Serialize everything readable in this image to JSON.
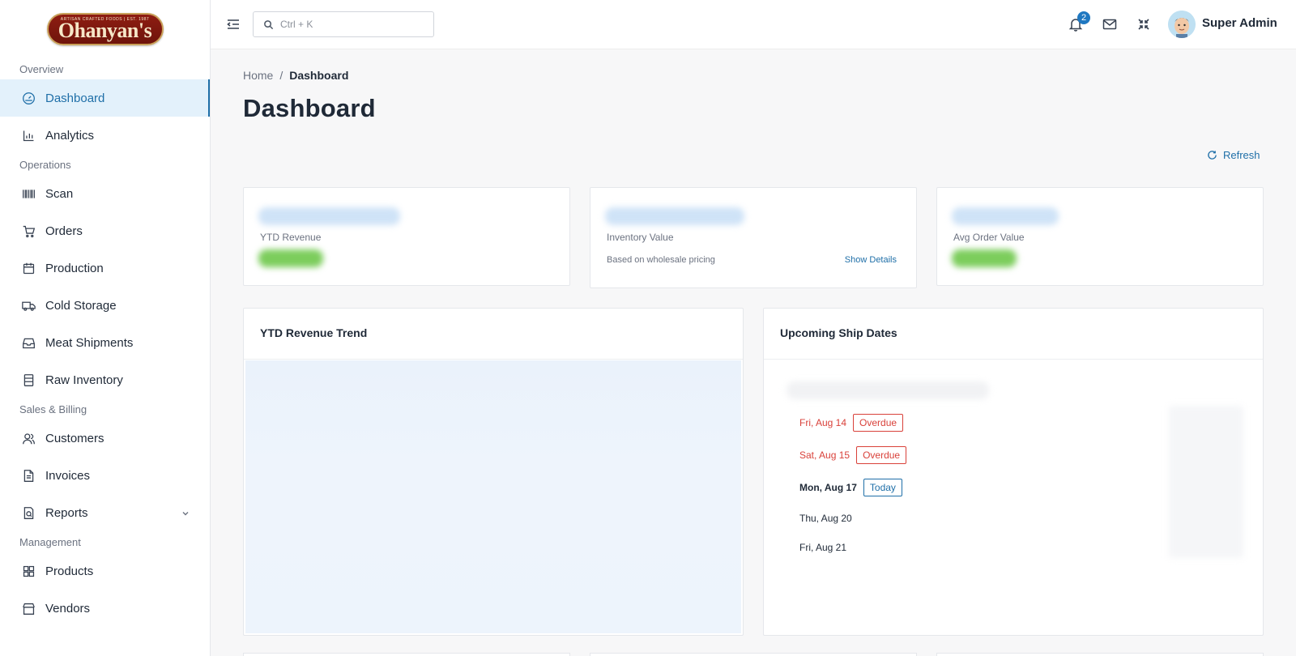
{
  "brand": {
    "logo_text": "Ohanyan's",
    "logo_tagline": "ARTISAN CRAFTED FOODS | EST. 1987"
  },
  "sidebar": {
    "sections": [
      {
        "label": "Overview"
      },
      {
        "label": "Operations"
      },
      {
        "label": "Sales & Billing"
      },
      {
        "label": "Management"
      }
    ],
    "items": [
      {
        "label": "Dashboard",
        "icon": "gauge-icon",
        "active": true
      },
      {
        "label": "Analytics",
        "icon": "bar-chart-icon"
      },
      {
        "label": "Scan",
        "icon": "barcode-icon"
      },
      {
        "label": "Orders",
        "icon": "cart-icon"
      },
      {
        "label": "Production",
        "icon": "calendar-icon"
      },
      {
        "label": "Cold Storage",
        "icon": "truck-icon"
      },
      {
        "label": "Meat Shipments",
        "icon": "inbox-icon"
      },
      {
        "label": "Raw Inventory",
        "icon": "building-icon"
      },
      {
        "label": "Customers",
        "icon": "users-icon"
      },
      {
        "label": "Invoices",
        "icon": "file-icon"
      },
      {
        "label": "Reports",
        "icon": "report-icon"
      },
      {
        "label": "Products",
        "icon": "grid-icon"
      },
      {
        "label": "Vendors",
        "icon": "store-icon"
      }
    ]
  },
  "topbar": {
    "search_placeholder": "Ctrl + K",
    "notification_count": "2",
    "user_name": "Super Admin"
  },
  "main": {
    "breadcrumb": {
      "home": "Home",
      "separator": "/",
      "current": "Dashboard"
    },
    "title": "Dashboard",
    "refresh_label": "Refresh",
    "stats": [
      {
        "label": "YTD Revenue"
      },
      {
        "label": "Inventory Value",
        "sub": "Based on wholesale pricing",
        "action": "Show Details"
      },
      {
        "label": "Avg Order Value"
      }
    ],
    "revenue_card": {
      "title": "YTD Revenue Trend"
    },
    "ship_card": {
      "title": "Upcoming Ship Dates",
      "rows": [
        {
          "date": "Fri, Aug 14",
          "tag": "Overdue",
          "status": "overdue"
        },
        {
          "date": "Sat, Aug 15",
          "tag": "Overdue",
          "status": "overdue"
        },
        {
          "date": "Mon, Aug 17",
          "tag": "Today",
          "status": "today"
        },
        {
          "date": "Thu, Aug 20",
          "tag": "",
          "status": "upcoming"
        },
        {
          "date": "Fri, Aug 21",
          "tag": "",
          "status": "upcoming"
        }
      ]
    }
  },
  "colors": {
    "accent": "#1f6fa8",
    "active_bg": "#e3f1fb",
    "overdue": "#d9413a",
    "badge": "#1f78c1",
    "brand_red": "#8e1d12"
  }
}
